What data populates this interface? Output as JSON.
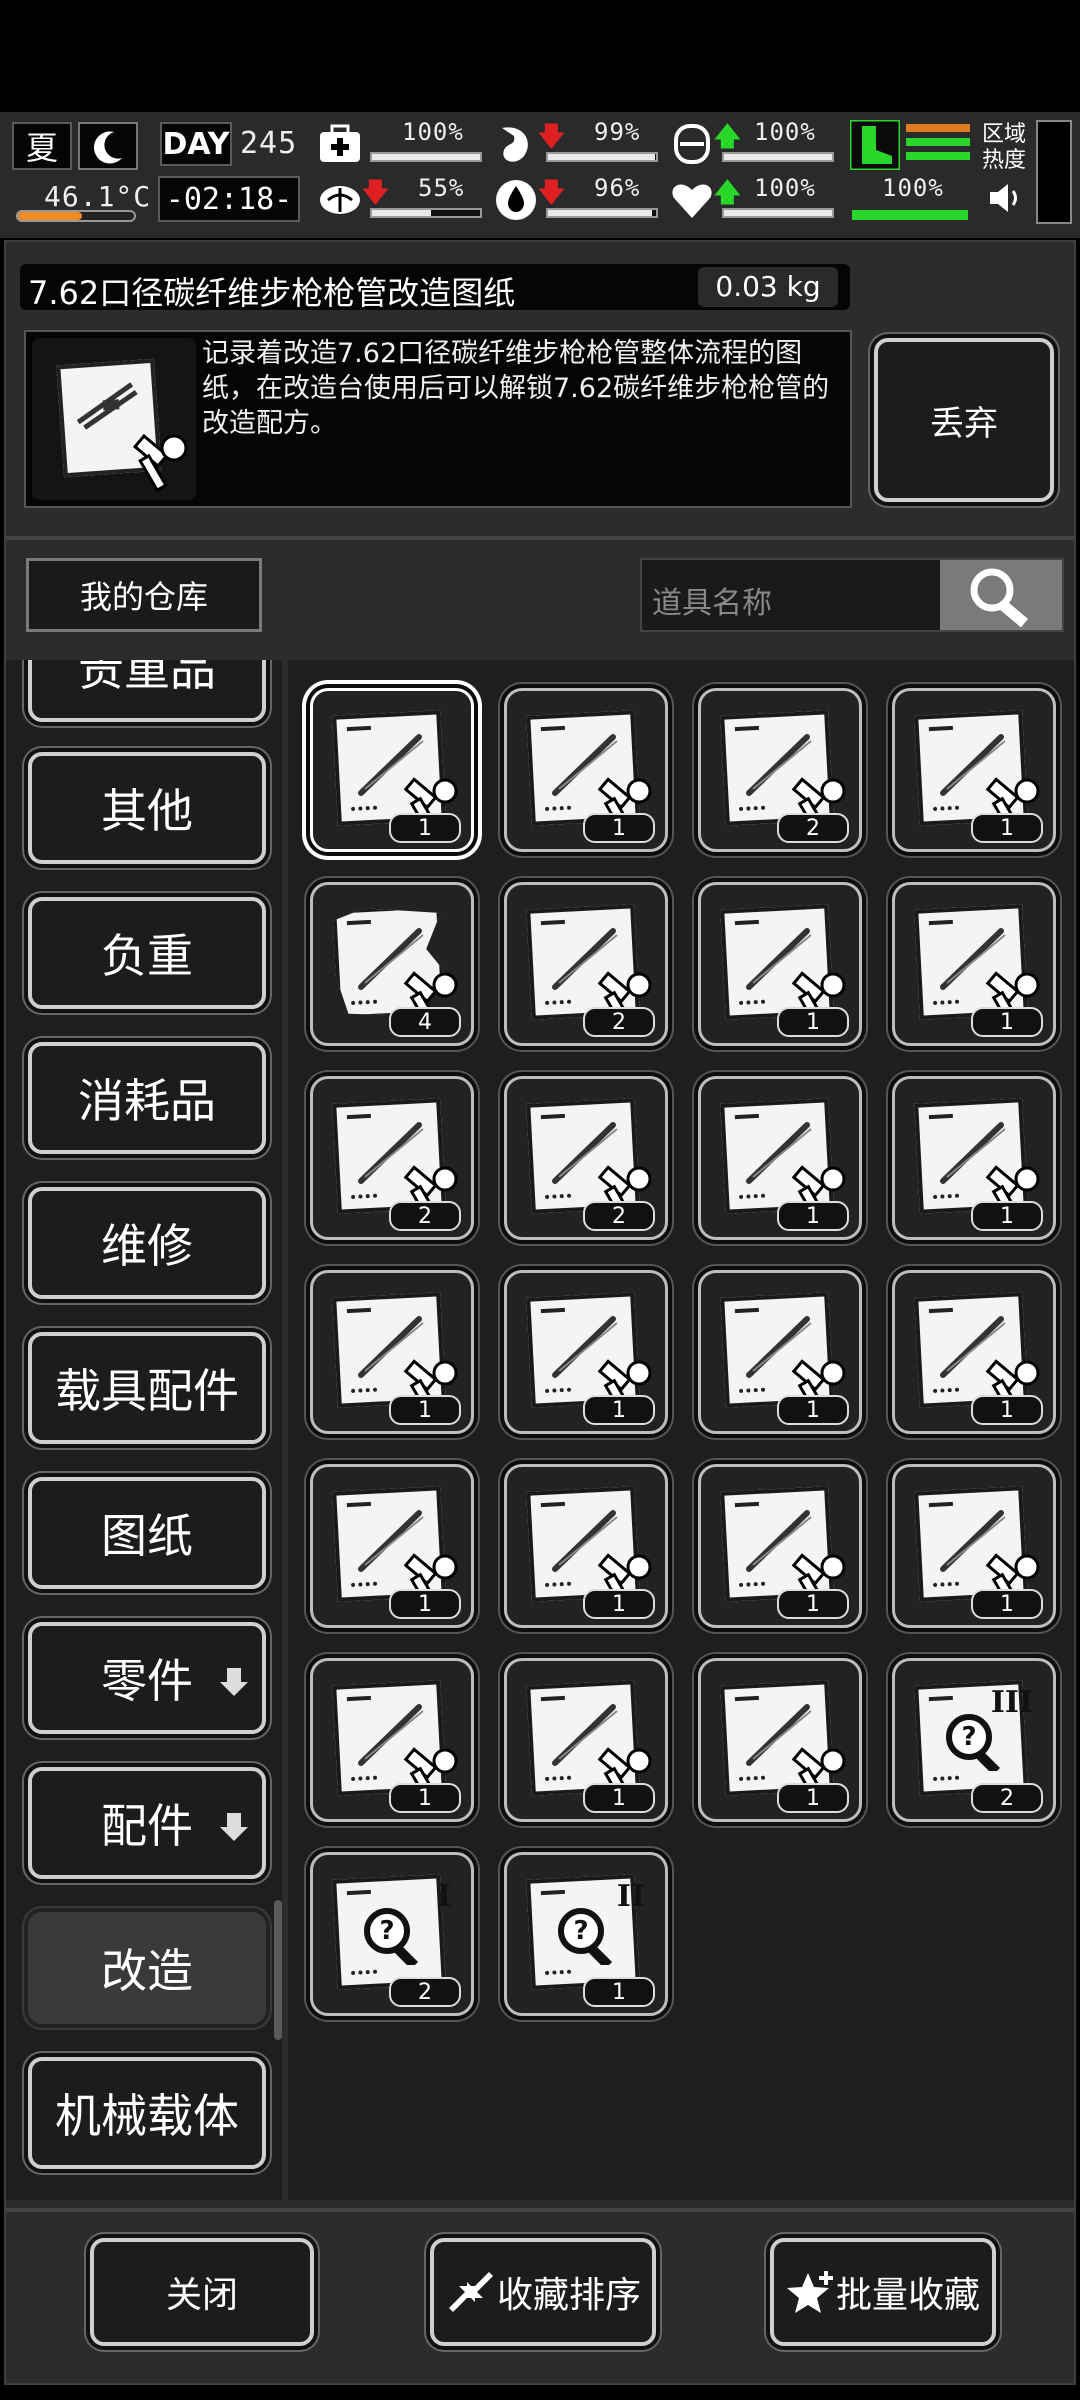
{
  "status": {
    "season": "夏",
    "temperature": "46.1°C",
    "day_label": "DAY",
    "day_number": "245",
    "clock": "-02:18-",
    "stats": [
      {
        "name": "health",
        "value": "100%",
        "fill": 1.0,
        "trend": ""
      },
      {
        "name": "hunger",
        "value": "99%",
        "fill": 0.99,
        "trend": "down"
      },
      {
        "name": "armor",
        "value": "100%",
        "fill": 1.0,
        "trend": "up"
      },
      {
        "name": "mental",
        "value": "55%",
        "fill": 0.55,
        "trend": "down"
      },
      {
        "name": "thirst",
        "value": "96%",
        "fill": 0.96,
        "trend": "down"
      },
      {
        "name": "mood",
        "value": "100%",
        "fill": 1.0,
        "trend": "up"
      }
    ],
    "stamina": "100%",
    "zone_heat_label": "区域热度"
  },
  "item": {
    "name": "7.62口径碳纤维步枪枪管改造图纸",
    "weight": "0.03 kg",
    "description": "记录着改造7.62口径碳纤维步枪枪管整体流程的图纸，在改造台使用后可以解锁7.62碳纤维步枪枪管的改造配方。",
    "discard_label": "丢弃"
  },
  "storage": {
    "title": "我的仓库",
    "search_placeholder": "道具名称"
  },
  "categories": [
    {
      "label": "贵重品",
      "key": "valuables"
    },
    {
      "label": "其他",
      "key": "other"
    },
    {
      "label": "负重",
      "key": "load"
    },
    {
      "label": "消耗品",
      "key": "consumables"
    },
    {
      "label": "维修",
      "key": "repair"
    },
    {
      "label": "载具配件",
      "key": "vehicle-parts"
    },
    {
      "label": "图纸",
      "key": "blueprints"
    },
    {
      "label": "零件",
      "key": "components"
    },
    {
      "label": "配件",
      "key": "accessories"
    },
    {
      "label": "改造",
      "key": "modify"
    },
    {
      "label": "机械载体",
      "key": "mech-carrier"
    }
  ],
  "active_category": "改造",
  "items": [
    {
      "icon": "rifle-barrel-blueprint-icon",
      "count": "1",
      "selected": true
    },
    {
      "icon": "blade-blueprint-icon",
      "count": "1"
    },
    {
      "icon": "knife-blueprint-icon",
      "count": "2"
    },
    {
      "icon": "barrel-blueprint-icon",
      "count": "1"
    },
    {
      "icon": "torn-blueprint-icon",
      "count": "4"
    },
    {
      "icon": "trigger-blueprint-icon",
      "count": "2"
    },
    {
      "icon": "sword-blueprint-icon",
      "count": "1"
    },
    {
      "icon": "mechanism-blueprint-icon",
      "count": "1"
    },
    {
      "icon": "axe-blueprint-icon",
      "count": "2"
    },
    {
      "icon": "katana-blueprint-icon",
      "count": "2"
    },
    {
      "icon": "machete-blueprint-icon",
      "count": "1"
    },
    {
      "icon": "serrated-blade-blueprint-icon",
      "count": "1"
    },
    {
      "icon": "sickle-blueprint-icon",
      "count": "1"
    },
    {
      "icon": "beast-blueprint-icon",
      "count": "1"
    },
    {
      "icon": "scythe-blueprint-icon",
      "count": "1"
    },
    {
      "icon": "magazine-blueprint-icon",
      "count": "1"
    },
    {
      "icon": "battle-axe-blueprint-icon",
      "count": "1"
    },
    {
      "icon": "spiked-blade-blueprint-icon",
      "count": "1"
    },
    {
      "icon": "saw-blade-blueprint-icon",
      "count": "1"
    },
    {
      "icon": "spear-blueprint-icon",
      "count": "1"
    },
    {
      "icon": "vest-blueprint-icon",
      "count": "1"
    },
    {
      "icon": "whip-blueprint-icon",
      "count": "1"
    },
    {
      "icon": "flame-sword-blueprint-icon",
      "count": "1"
    },
    {
      "icon": "unknown-blueprint-iii-icon",
      "count": "2",
      "roman": "III"
    },
    {
      "icon": "unknown-blueprint-i-icon",
      "count": "2",
      "roman": "I"
    },
    {
      "icon": "unknown-blueprint-ii-icon",
      "count": "1",
      "roman": "II"
    }
  ],
  "bottom": {
    "close_label": "关闭",
    "sort_label": "收藏排序",
    "batch_fav_label": "批量收藏"
  }
}
